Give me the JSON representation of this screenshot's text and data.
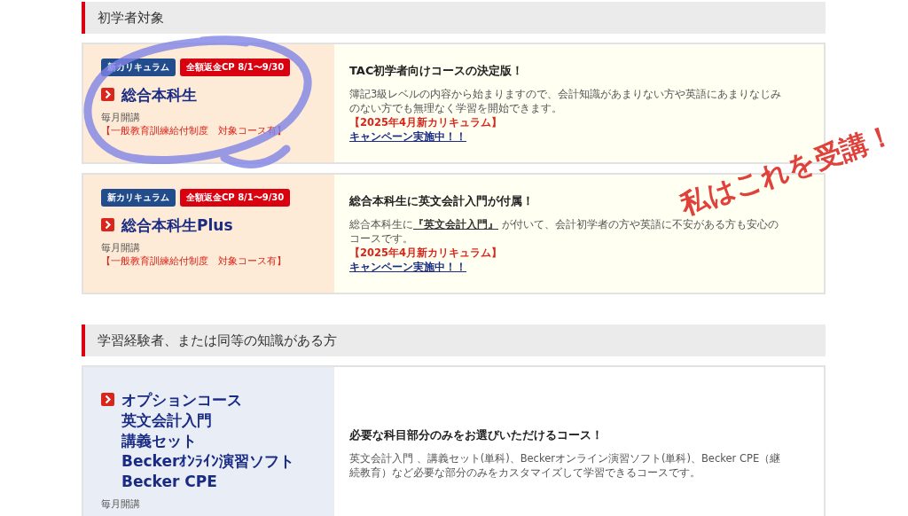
{
  "sections": [
    {
      "heading": "初学者対象",
      "kind": "beginner",
      "courses": [
        {
          "badges": [
            {
              "label": "新カリキュラム",
              "kind": "curriculum"
            },
            {
              "label": "全額返金CP 8/1〜9/30",
              "kind": "campaign"
            }
          ],
          "title_lines": [
            "総合本科生"
          ],
          "schedule": "毎月開講",
          "subsidy": "【一般教育訓練給付制度　対象コース有】",
          "headline": "TAC初学者向けコースの決定版！",
          "description": [
            {
              "kind": "text",
              "text": "簿記3級レベルの内容から始まりますので、会計知識があまりない方や英語にあまりなじみのない方でも無理なく学習を開始できます。"
            }
          ],
          "notice": "【2025年4月新カリキュラム】",
          "link": "キャンペーン実施中！！"
        },
        {
          "badges": [
            {
              "label": "新カリキュラム",
              "kind": "curriculum"
            },
            {
              "label": "全額返金CP 8/1〜9/30",
              "kind": "campaign"
            }
          ],
          "title_lines": [
            "総合本科生Plus"
          ],
          "schedule": "毎月開講",
          "subsidy": "【一般教育訓練給付制度　対象コース有】",
          "headline": "総合本科生に英文会計入門が付属！",
          "description": [
            {
              "kind": "text",
              "text": "総合本科生に"
            },
            {
              "kind": "link",
              "text": "『英文会計入門』"
            },
            {
              "kind": "text",
              "text": " が付いて、会計初学者の方や英語に不安がある方も安心のコースです。"
            }
          ],
          "notice": "【2025年4月新カリキュラム】",
          "link": "キャンペーン実施中！！"
        }
      ]
    },
    {
      "heading": "学習経験者、または同等の知識がある方",
      "kind": "experienced",
      "courses": [
        {
          "title_lines": [
            "オプションコース",
            "英文会計入門",
            "講義セット",
            "Beckerｵﾝﾗｲﾝ演習ソフト",
            "Becker CPE"
          ],
          "schedule": "毎月開講",
          "headline": "必要な科目部分のみをお選びいただけるコース！",
          "description": [
            {
              "kind": "text",
              "text": "英文会計入門 、講義セット(単科)、Beckerオンライン演習ソフト(単科)、Becker CPE（継続教育）など必要な部分のみをカスタマイズして学習できるコースです。"
            }
          ]
        }
      ]
    }
  ],
  "annotation": {
    "text": "私はこれを受講！",
    "circled": true
  }
}
